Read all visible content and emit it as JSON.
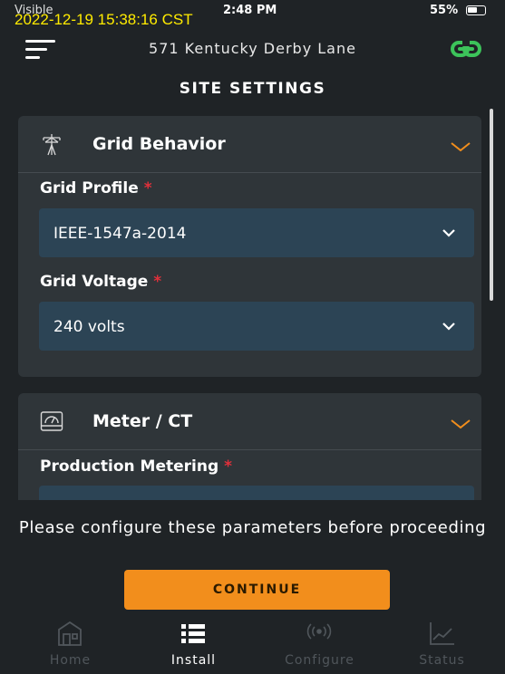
{
  "status_bar": {
    "carrier": "Visible",
    "time": "2:48 PM",
    "battery": "55%"
  },
  "timestamp_overlay": "2022-12-19 15:38:16 CST",
  "header": {
    "address": "571 Kentucky Derby Lane",
    "menu_icon": "hamburger-icon",
    "link_icon": "link-icon"
  },
  "page_title": "SITE SETTINGS",
  "sections": [
    {
      "title": "Grid Behavior",
      "icon": "power-tower-icon",
      "fields": [
        {
          "label": "Grid Profile",
          "required_mark": "*",
          "value": "IEEE-1547a-2014"
        },
        {
          "label": "Grid Voltage",
          "required_mark": "*",
          "value": "240 volts"
        }
      ]
    },
    {
      "title": "Meter / CT",
      "icon": "meter-icon",
      "fields": [
        {
          "label": "Production Metering",
          "required_mark": "*",
          "value": ""
        }
      ]
    }
  ],
  "footer": {
    "message": "Please configure these parameters before proceeding",
    "continue_label": "CONTINUE"
  },
  "tabs": [
    {
      "label": "Home",
      "icon": "home-icon",
      "active": false
    },
    {
      "label": "Install",
      "icon": "list-icon",
      "active": true
    },
    {
      "label": "Configure",
      "icon": "broadcast-icon",
      "active": false
    },
    {
      "label": "Status",
      "icon": "chart-icon",
      "active": false
    }
  ],
  "colors": {
    "background": "#1f2326",
    "card": "#2f3539",
    "select": "#2c4455",
    "accent": "#f28e1c",
    "link_icon": "#3cc35a",
    "required": "#e0303a",
    "timestamp": "#ffeb00"
  }
}
